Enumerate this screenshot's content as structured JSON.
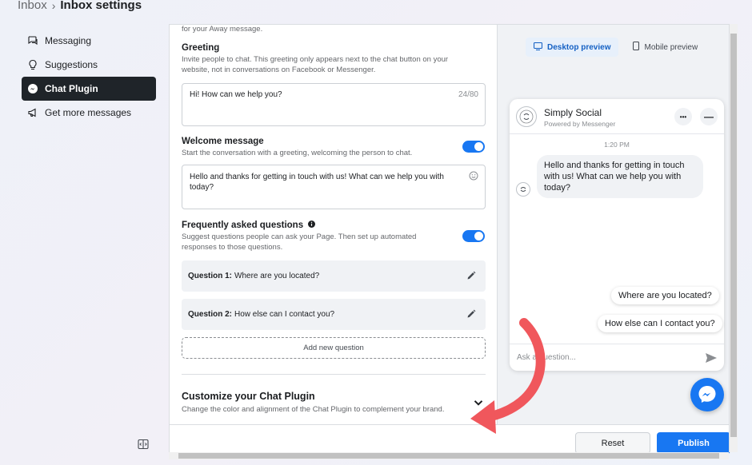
{
  "breadcrumb": {
    "root": "Inbox",
    "current": "Inbox settings"
  },
  "sidebar": {
    "items": [
      {
        "label": "Messaging"
      },
      {
        "label": "Suggestions"
      },
      {
        "label": "Chat Plugin"
      },
      {
        "label": "Get more messages"
      }
    ]
  },
  "settings": {
    "away_tail": "for your Away message.",
    "greeting": {
      "title": "Greeting",
      "desc": "Invite people to chat. This greeting only appears next to the chat button on your website, not in conversations on Facebook or Messenger.",
      "value": "Hi! How can we help you?",
      "counter": "24/80"
    },
    "welcome": {
      "title": "Welcome message",
      "desc": "Start the conversation with a greeting, welcoming the person to chat.",
      "value": "Hello and thanks for getting in touch with us! What can we help you with today?"
    },
    "faq": {
      "title": "Frequently asked questions",
      "desc": "Suggest questions people can ask your Page. Then set up automated responses to those questions.",
      "questions": [
        {
          "label": "Question 1:",
          "text": "Where are you located?"
        },
        {
          "label": "Question 2:",
          "text": "How else can I contact you?"
        }
      ],
      "add_label": "Add new question"
    },
    "customize": {
      "title": "Customize your Chat Plugin",
      "desc": "Change the color and alignment of the Chat Plugin to complement your brand."
    }
  },
  "footer": {
    "reset_label": "Reset",
    "publish_label": "Publish"
  },
  "preview": {
    "tabs": [
      {
        "label": "Desktop preview"
      },
      {
        "label": "Mobile preview"
      }
    ],
    "chat": {
      "name": "Simply Social",
      "sub": "Powered by Messenger",
      "more": "•••",
      "minimize": "—",
      "time": "1:20 PM",
      "message": "Hello and thanks for getting in touch with us! What can we help you with today?",
      "quick_replies": [
        "Where are you located?",
        "How else can I contact you?"
      ],
      "composer_placeholder": "Ask a question..."
    }
  },
  "colors": {
    "accent": "#1877f2",
    "sidebar_active_bg": "#1f2429",
    "arrow": "#f0575c"
  }
}
